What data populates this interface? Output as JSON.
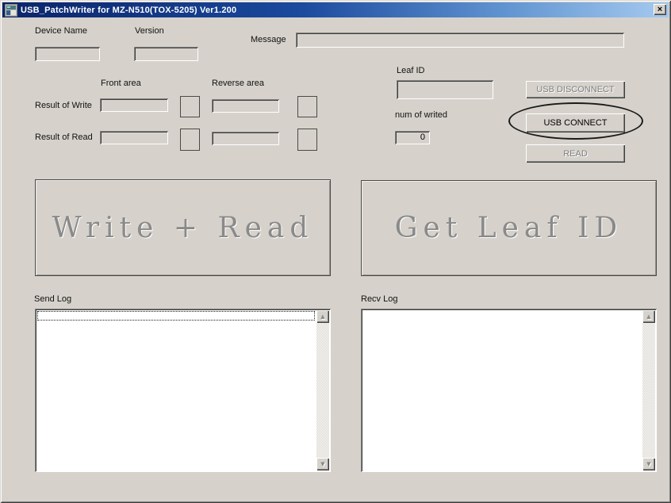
{
  "window": {
    "title": "USB_PatchWriter for MZ-N510(TOX-5205) Ver1.200"
  },
  "icons": {
    "close": "×",
    "scroll_up": "▲",
    "scroll_down": "▼"
  },
  "device_info": {
    "device_name_label": "Device Name",
    "device_name_value": "",
    "version_label": "Version",
    "version_value": "",
    "message_label": "Message",
    "message_value": ""
  },
  "result_grid": {
    "front_area_label": "Front area",
    "reverse_area_label": "Reverse area",
    "result_of_write_label": "Result of Write",
    "result_of_read_label": "Result of Read",
    "write_front_value": "",
    "write_reverse_value": "",
    "read_front_value": "",
    "read_reverse_value": ""
  },
  "leaf_panel": {
    "leaf_id_label": "Leaf ID",
    "leaf_id_value": "",
    "num_of_writed_label": "num of writed",
    "num_of_writed_value": "0"
  },
  "usb_buttons": {
    "disconnect_label": "USB DISCONNECT",
    "connect_label": "USB CONNECT",
    "read_label": "READ"
  },
  "main_buttons": {
    "write_read_label": "Write + Read",
    "get_leaf_id_label": "Get Leaf ID"
  },
  "logs": {
    "send_log_label": "Send Log",
    "recv_log_label": "Recv Log"
  },
  "annotation": {
    "type": "ellipse-highlight-around-usb-connect"
  },
  "colors": {
    "dialog_bg": "#d6d2cb",
    "title_gradient_start": "#0a246a",
    "title_gradient_end": "#a6caf0",
    "disabled_text": "#808080",
    "enabled_text": "#000000",
    "listbox_bg": "#ffffff",
    "annotation_stroke": "#1a1a1a"
  }
}
